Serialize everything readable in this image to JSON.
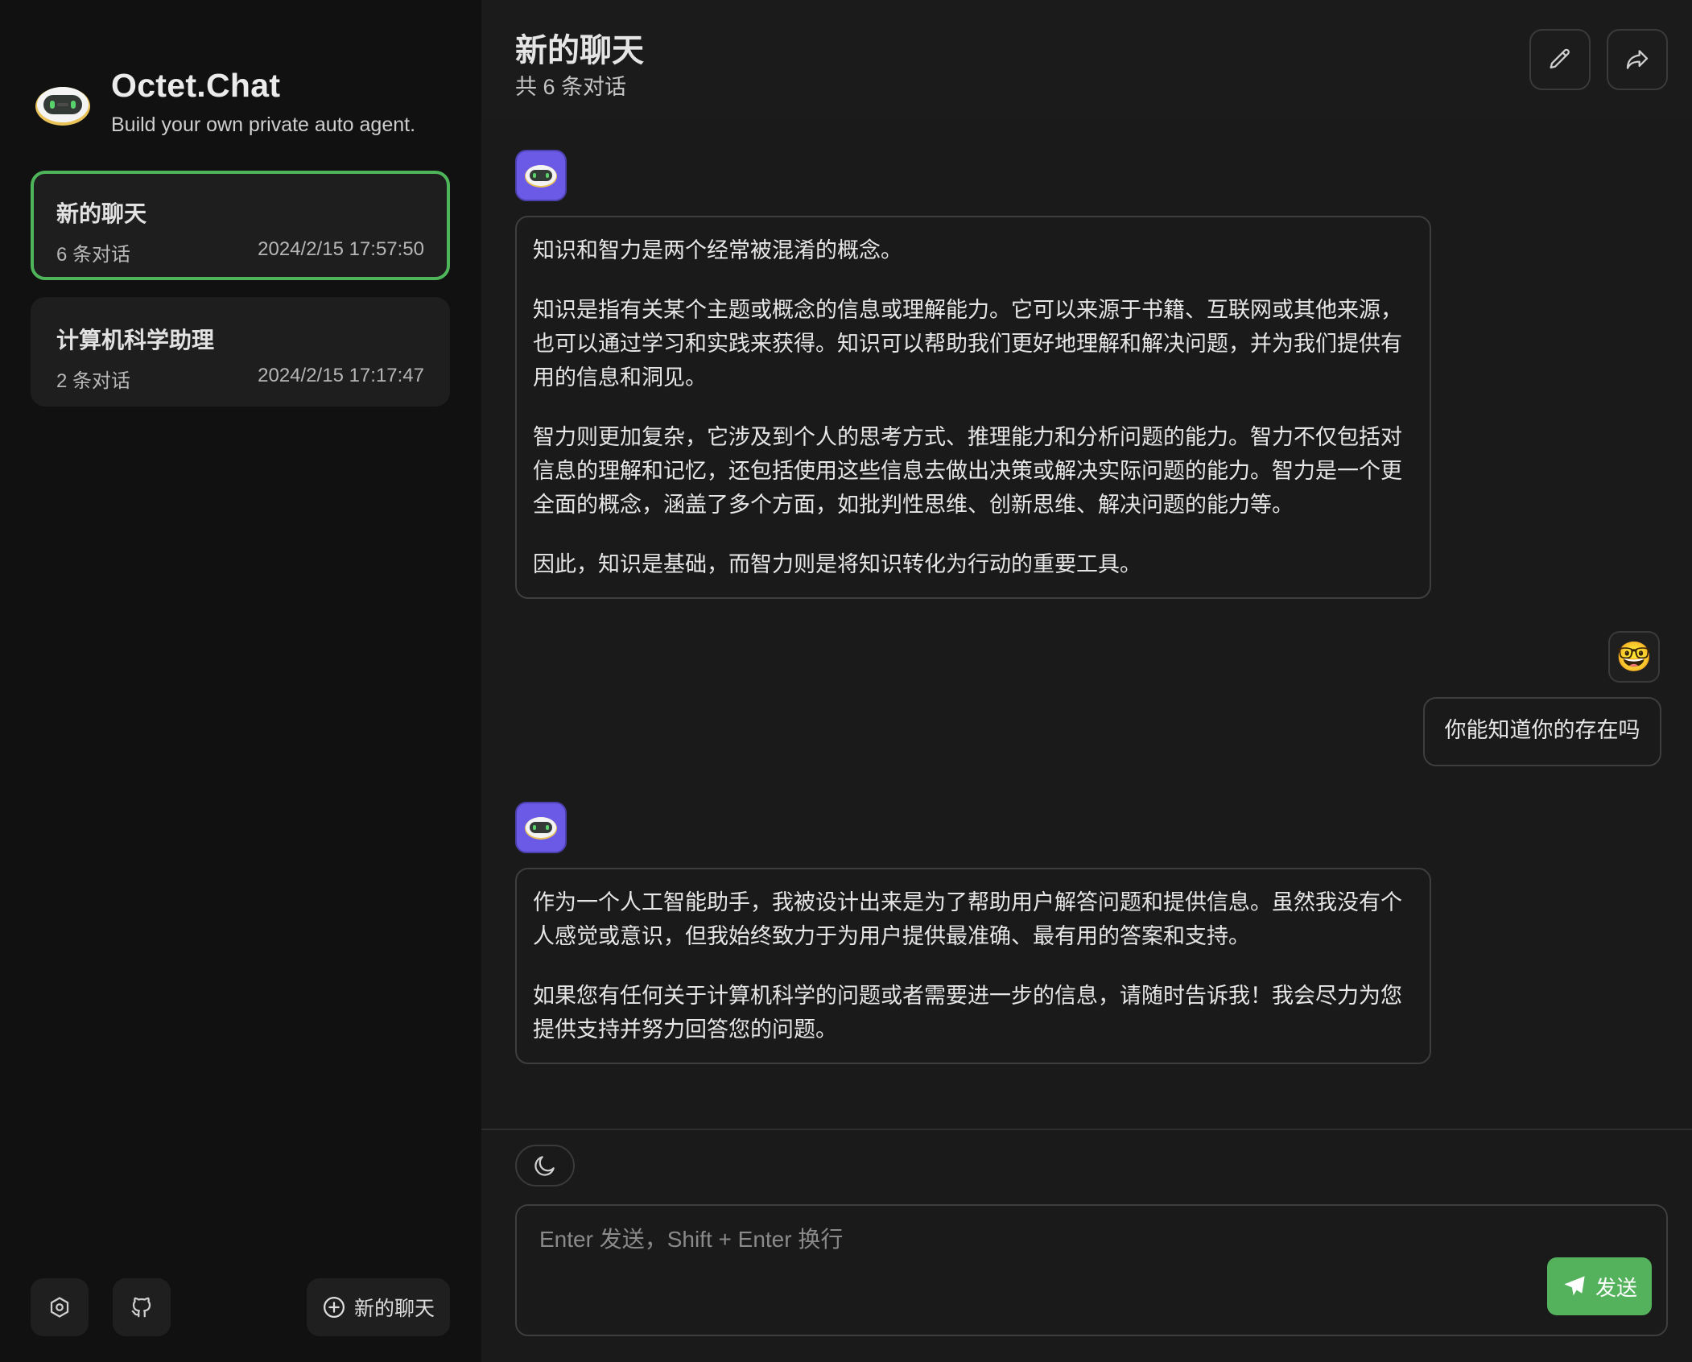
{
  "app": {
    "name": "Octet.Chat",
    "tagline": "Build your own private auto agent."
  },
  "sidebar": {
    "chats": [
      {
        "title": "新的聊天",
        "count": "6 条对话",
        "time": "2024/2/15 17:57:50",
        "active": true
      },
      {
        "title": "计算机科学助理",
        "count": "2 条对话",
        "time": "2024/2/15 17:17:47",
        "active": false
      }
    ],
    "footer": {
      "settings_icon": "settings-icon",
      "github_icon": "github-icon",
      "new_chat_label": "新的聊天"
    }
  },
  "header": {
    "title": "新的聊天",
    "subtitle": "共 6 条对话",
    "edit_icon": "pencil-icon",
    "share_icon": "share-icon"
  },
  "messages": [
    {
      "role": "assistant",
      "paragraphs": [
        "知识和智力是两个经常被混淆的概念。",
        "知识是指有关某个主题或概念的信息或理解能力。它可以来源于书籍、互联网或其他来源，也可以通过学习和实践来获得。知识可以帮助我们更好地理解和解决问题，并为我们提供有用的信息和洞见。",
        "智力则更加复杂，它涉及到个人的思考方式、推理能力和分析问题的能力。智力不仅包括对信息的理解和记忆，还包括使用这些信息去做出决策或解决实际问题的能力。智力是一个更全面的概念，涵盖了多个方面，如批判性思维、创新思维、解决问题的能力等。",
        "因此，知识是基础，而智力则是将知识转化为行动的重要工具。"
      ]
    },
    {
      "role": "user",
      "avatar": "🤓",
      "paragraphs": [
        "你能知道你的存在吗"
      ]
    },
    {
      "role": "assistant",
      "paragraphs": [
        "作为一个人工智能助手，我被设计出来是为了帮助用户解答问题和提供信息。虽然我没有个人感觉或意识，但我始终致力于为用户提供最准确、最有用的答案和支持。",
        "如果您有任何关于计算机科学的问题或者需要进一步的信息，请随时告诉我！我会尽力为您提供支持并努力回答您的问题。"
      ]
    }
  ],
  "composer": {
    "theme_icon": "moon-icon",
    "placeholder": "Enter 发送，Shift + Enter 换行",
    "send_label": "发送",
    "send_icon": "paper-plane-icon"
  },
  "colors": {
    "accent": "#54b25d",
    "active_border": "#4fb55a",
    "bot_avatar": "#6a5ae6"
  }
}
